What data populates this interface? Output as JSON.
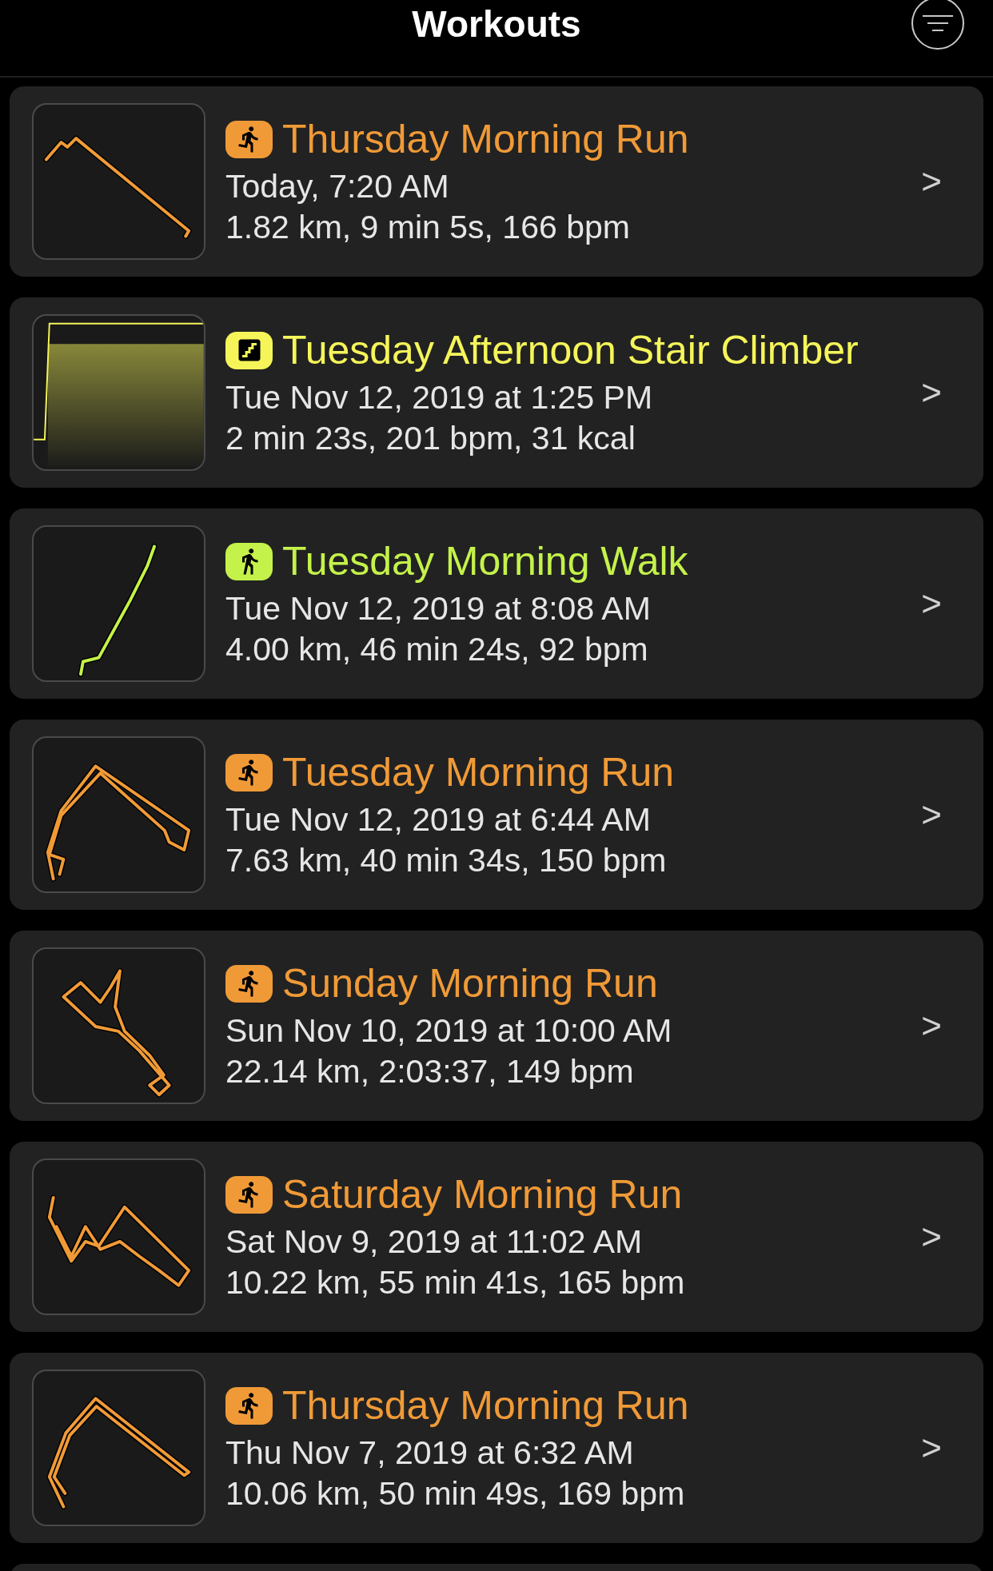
{
  "header": {
    "title": "Workouts"
  },
  "workouts": [
    {
      "kind": "run",
      "thumbnail": {
        "kind": "route"
      },
      "color": "#f09a37",
      "title": "Thursday Morning Run",
      "date": "Today, 7:20 AM",
      "stats": "1.82 km, 9 min 5s, 166 bpm",
      "chevron": ">"
    },
    {
      "kind": "stairs",
      "thumbnail": {
        "kind": "chart"
      },
      "color": "#f5f55a",
      "title": "Tuesday Afternoon Stair Climber",
      "date": "Tue Nov 12, 2019 at 1:25 PM",
      "stats": "2 min 23s, 201 bpm, 31 kcal",
      "chevron": ">"
    },
    {
      "kind": "walk",
      "thumbnail": {
        "kind": "route"
      },
      "color": "#c4f24a",
      "title": "Tuesday Morning Walk",
      "date": "Tue Nov 12, 2019 at 8:08 AM",
      "stats": "4.00 km, 46 min 24s, 92 bpm",
      "chevron": ">"
    },
    {
      "kind": "run",
      "thumbnail": {
        "kind": "route"
      },
      "color": "#f09a37",
      "title": "Tuesday Morning Run",
      "date": "Tue Nov 12, 2019 at 6:44 AM",
      "stats": "7.63 km, 40 min 34s, 150 bpm",
      "chevron": ">"
    },
    {
      "kind": "run",
      "thumbnail": {
        "kind": "route"
      },
      "color": "#f09a37",
      "title": "Sunday Morning Run",
      "date": "Sun Nov 10, 2019 at 10:00 AM",
      "stats": "22.14 km, 2:03:37, 149 bpm",
      "chevron": ">"
    },
    {
      "kind": "run",
      "thumbnail": {
        "kind": "route"
      },
      "color": "#f09a37",
      "title": "Saturday Morning Run",
      "date": "Sat Nov 9, 2019 at 11:02 AM",
      "stats": "10.22 km, 55 min 41s, 165 bpm",
      "chevron": ">"
    },
    {
      "kind": "run",
      "thumbnail": {
        "kind": "route"
      },
      "color": "#f09a37",
      "title": "Thursday Morning Run",
      "date": "Thu Nov 7, 2019 at 6:32 AM",
      "stats": "10.06 km, 50 min 49s, 169 bpm",
      "chevron": ">"
    }
  ]
}
